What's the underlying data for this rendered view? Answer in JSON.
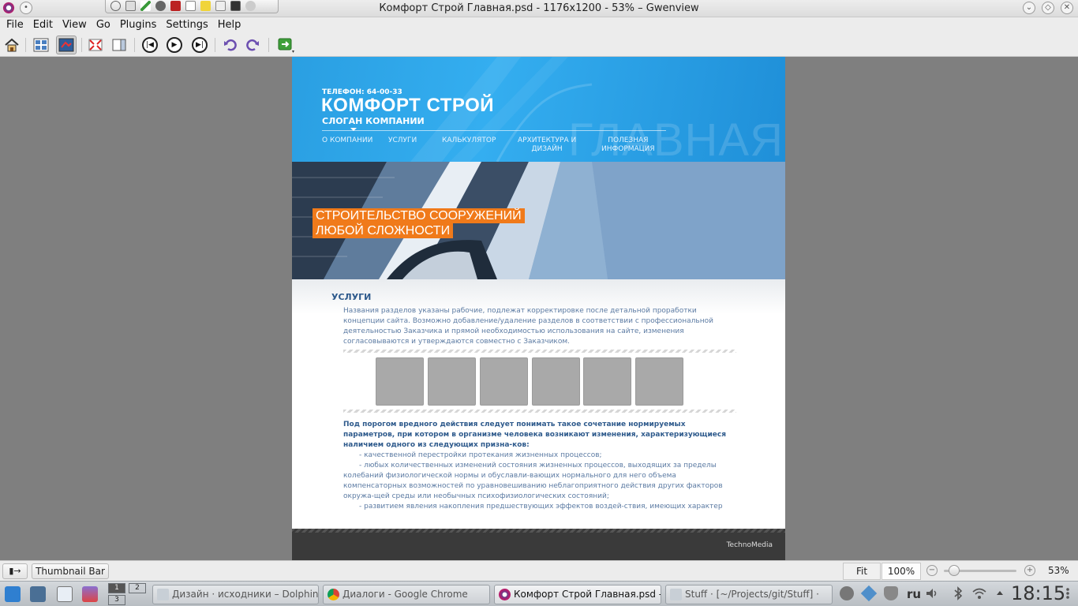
{
  "window": {
    "title": "Комфорт Строй Главная.psd - 1176x1200 - 53% – Gwenview"
  },
  "menu": [
    "File",
    "Edit",
    "View",
    "Go",
    "Plugins",
    "Settings",
    "Help"
  ],
  "toolbar": {
    "icons": [
      "home-icon",
      "browse-icon",
      "view-icon",
      "fullscreen-icon",
      "sidebar-icon",
      "previous-icon",
      "play-icon",
      "next-icon",
      "rotate-left-icon",
      "rotate-right-icon",
      "share-icon"
    ]
  },
  "psd": {
    "phone": "ТЕЛЕФОН: 64-00-33",
    "brand": "КОМФОРТ СТРОЙ",
    "slogan": "СЛОГАН КОМПАНИИ",
    "watermark": "ГЛАВНАЯ",
    "nav": [
      {
        "line1": "О КОМПАНИИ",
        "line2": ""
      },
      {
        "line1": "УСЛУГИ",
        "line2": ""
      },
      {
        "line1": "КАЛЬКУЛЯТОР",
        "line2": ""
      },
      {
        "line1": "АРХИТЕКТУРА И",
        "line2": "ДИЗАЙН"
      },
      {
        "line1": "ПОЛЕЗНАЯ",
        "line2": "ИНФОРМАЦИЯ"
      }
    ],
    "hero_line1": "СТРОИТЕЛЬСТВО СООРУЖЕНИЙ",
    "hero_line2": "ЛЮБОЙ СЛОЖНОСТИ",
    "services_title": "УСЛУГИ",
    "services_intro": "Названия разделов указаны рабочие, подлежат корректировке после детальной проработки концепции сайта. Возможно добавление/удаление разделов в соответствии с профессиональной деятельностью Заказчика и прямой необходимостью использования на сайте, изменения согласовываются и утверждаются совместно с Заказчиком.",
    "bold_paragraph": "Под порогом вредного действия следует понимать такое сочетание нормируемых параметров, при котором в организме человека возникают изменения, характеризующиеся наличием одного из следующих призна-ков:",
    "list_1": "- качественной перестройки протекания жизненных процессов;",
    "list_2": "- любых количественных изменений состояния жизненных процессов, выходящих за пределы колебаний физиологической нормы и обуславли-вающих нормального для него объема компенсаторных возможностей по уравновешиванию неблагоприятного действия других факторов окружа-щей среды или необычных психофизиологических состояний;",
    "list_3": "- развитием явления накопления предшествующих эффектов воздей-ствия, имеющих характер",
    "footer_credit": "TechnoMedia"
  },
  "statusbar": {
    "toggle": "▮→",
    "thumbnail_bar": "Thumbnail Bar",
    "fit": "Fit",
    "hundred": "100%",
    "zoom_percent": "53%",
    "zoom_level": 0.53
  },
  "taskbar": {
    "pager": [
      "1",
      "2",
      "3"
    ],
    "tasks": [
      {
        "label": "Дизайн · исходники – Dolphin",
        "active": false
      },
      {
        "label": "Диалоги - Google Chrome",
        "active": false
      },
      {
        "label": "Комфорт Строй Главная.psd -",
        "active": true
      },
      {
        "label": "Stuff · [~/Projects/git/Stuff] ·",
        "active": false
      }
    ],
    "keyboard_layout": "ru",
    "clock": "18:15"
  },
  "colors": {
    "header_blue": "#2a9fe2",
    "hero_orange": "#f07a1a",
    "heading_blue": "#2e5a8c"
  }
}
